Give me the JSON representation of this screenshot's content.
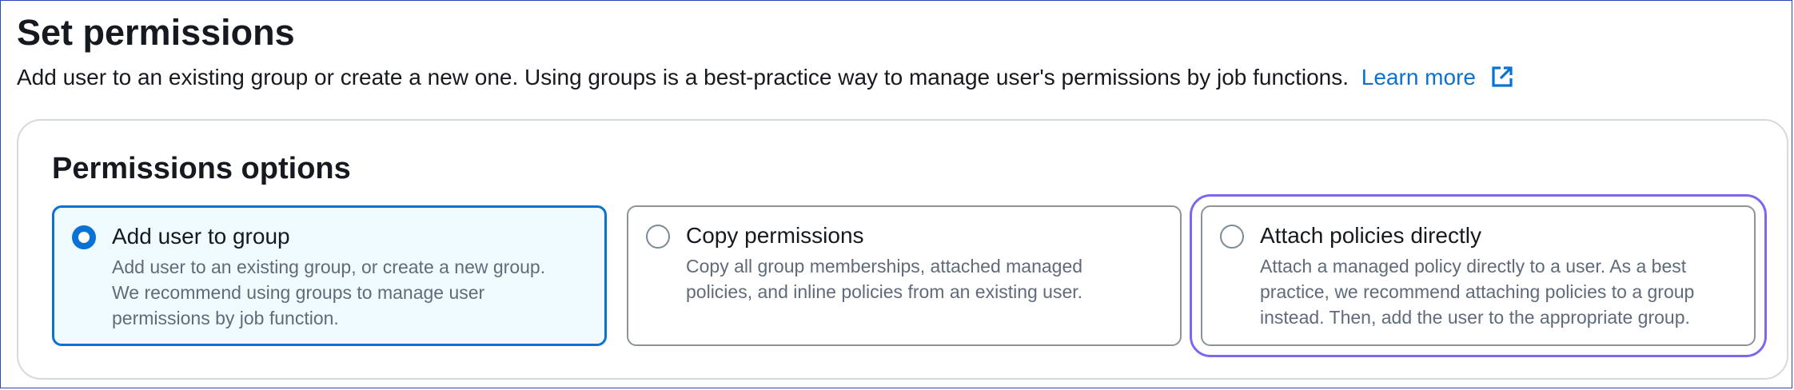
{
  "page": {
    "title": "Set permissions",
    "description": "Add user to an existing group or create a new one. Using groups is a best-practice way to manage user's permissions by job functions.",
    "learn_more": "Learn more",
    "learn_more_icon": "external-link-icon"
  },
  "colors": {
    "link": "#0972d3",
    "selected_border": "#0972d3",
    "selected_background": "#f0fbff",
    "focus_ring": "#7b68ee"
  },
  "permissions_options": {
    "title": "Permissions options",
    "options": [
      {
        "label": "Add user to group",
        "description_lines": [
          "Add user to an existing group, or create a new group.",
          "We recommend using groups to manage user",
          "permissions by job function."
        ],
        "selected": true
      },
      {
        "label": "Copy permissions",
        "description_lines": [
          "Copy all group memberships, attached managed",
          "policies, and inline policies from an existing user."
        ],
        "selected": false
      },
      {
        "label": "Attach policies directly",
        "description_lines": [
          "Attach a managed policy directly to a user. As a best",
          "practice, we recommend attaching policies to a group",
          "instead. Then, add the user to the appropriate group."
        ],
        "selected": false,
        "focused": true
      }
    ]
  }
}
